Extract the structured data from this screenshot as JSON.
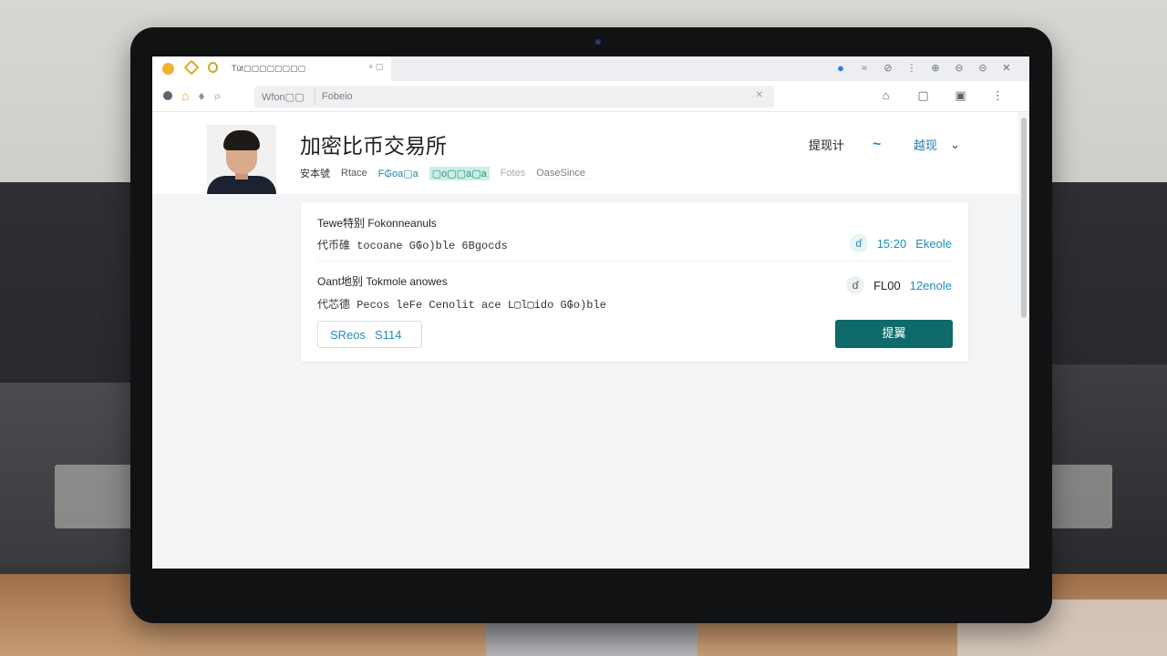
{
  "browser": {
    "tab_title": "Tüt▢▢▢▢▢▢▢▢",
    "tab_close": "× ▢",
    "window_icons": [
      "●",
      "≈",
      "⊘",
      "⋮",
      "⊕",
      "⊖",
      "⊝",
      "✕"
    ],
    "address_left": "Wfon▢▢",
    "address_right": "Fobeio",
    "address_clear": "✕",
    "toolbar_icons": [
      "⌂",
      "▢",
      "▣",
      "⋮"
    ]
  },
  "header": {
    "title": "加密比币交易所",
    "meta": [
      "安本號",
      "Rtace",
      "F₲oa▢a",
      "▢o▢▢a▢a",
      "Fotes",
      "OaseSince"
    ],
    "right_link_1": "提现计",
    "right_icon": "~",
    "right_link_2": "越现",
    "right_chevron": "⌄"
  },
  "card": {
    "row1": {
      "title": "Tewe特别 Fokonneanuls",
      "details": "代币碓 tocoane G₲o)ble 6Bgocds",
      "icon": "ɗ",
      "time": "15:20",
      "tag": "Ekeole"
    },
    "row2": {
      "title": "Oant地别 Tokmole anowes",
      "details": "代芯德 Pecos leFe Cenolit ace L▢l▢ido G₲o)ble",
      "icon": "ɗ",
      "value": "FL00",
      "tag": "12enole"
    },
    "chip_label": "SReos",
    "chip_value": "S114",
    "action_button": "提翼"
  }
}
